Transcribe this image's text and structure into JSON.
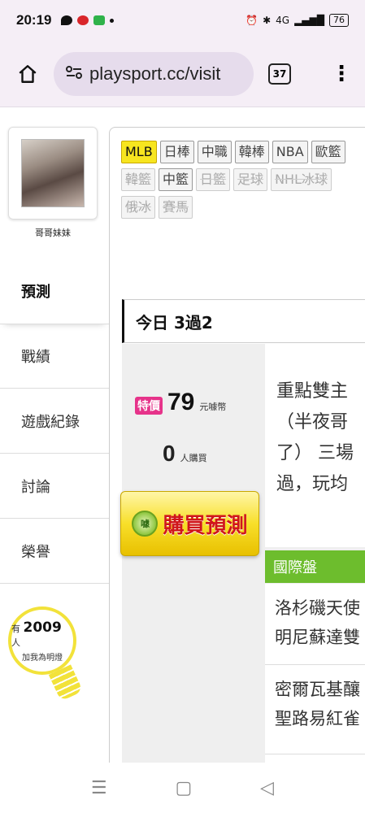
{
  "status_bar": {
    "time": "20:19",
    "battery": "76",
    "signal_text": "4G"
  },
  "browser": {
    "url": "playsport.cc/visit",
    "tab_count": "37"
  },
  "sidebar": {
    "avatar_name": "哥哥妹妹",
    "items": [
      {
        "label": "預測"
      },
      {
        "label": "戰績"
      },
      {
        "label": "遊戲紀錄"
      },
      {
        "label": "討論"
      },
      {
        "label": "榮譽"
      }
    ],
    "bulb": {
      "prefix": "有",
      "count": "2009",
      "suffix": "人",
      "line2": "加我為明燈"
    }
  },
  "sports": [
    {
      "label": "MLB",
      "state": "active"
    },
    {
      "label": "日棒",
      "state": "normal"
    },
    {
      "label": "中職",
      "state": "normal"
    },
    {
      "label": "韓棒",
      "state": "normal"
    },
    {
      "label": "NBA",
      "state": "normal"
    },
    {
      "label": "歐籃",
      "state": "normal"
    },
    {
      "label": "韓籃",
      "state": "disabled"
    },
    {
      "label": "中籃",
      "state": "normal"
    },
    {
      "label": "日籃",
      "state": "disabled"
    },
    {
      "label": "足球",
      "state": "disabled"
    },
    {
      "label": "NHL冰球",
      "state": "disabled"
    },
    {
      "label": "俄冰",
      "state": "disabled"
    },
    {
      "label": "賽馬",
      "state": "disabled"
    }
  ],
  "today": {
    "title": "今日 3過2"
  },
  "price": {
    "badge": "特價",
    "amount": "79",
    "unit": "元噱幣",
    "buyers": "0",
    "buyers_unit": "人購買"
  },
  "buy_button": {
    "coin": "噱",
    "label": "購買預測"
  },
  "description": {
    "lines": [
      "重點雙主",
      "（半夜哥",
      "了） 三場",
      "過，玩均"
    ]
  },
  "section": {
    "label": "國際盤"
  },
  "matches": [
    {
      "line1": "洛杉磯天使",
      "line2": "明尼蘇達雙"
    },
    {
      "line1": "密爾瓦基釀",
      "line2": "聖路易紅雀"
    }
  ],
  "colors": {
    "accent_yellow": "#f7e51f",
    "badge_pink": "#e6338a",
    "section_green": "#6dbd2d",
    "buy_red": "#d0161b"
  }
}
